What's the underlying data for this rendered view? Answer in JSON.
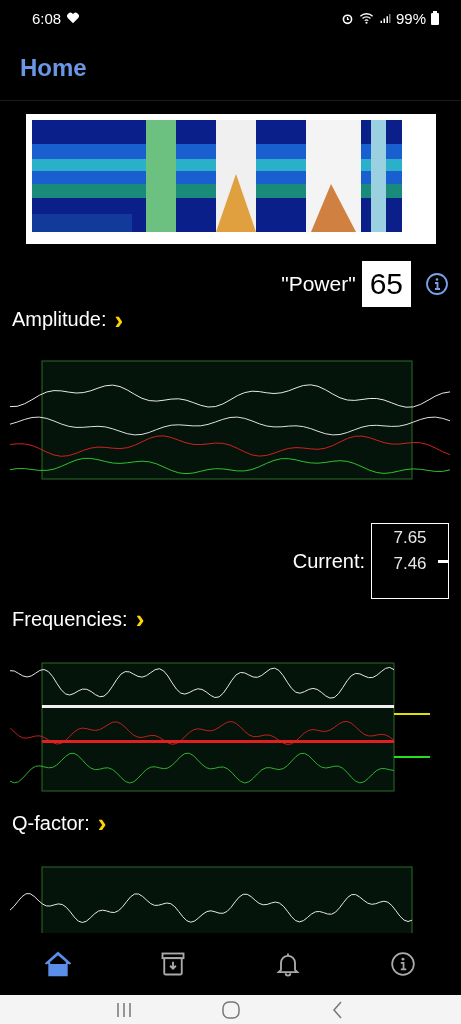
{
  "status_bar": {
    "time": "6:08",
    "battery": "99%"
  },
  "header": {
    "title": "Home"
  },
  "amplitude": {
    "label": "Amplitude:",
    "chevron": "›",
    "power_label": "\"Power\"",
    "power_value": "65"
  },
  "current": {
    "label": "Current:",
    "scale": [
      "7.65",
      "7.46"
    ]
  },
  "frequencies": {
    "label": "Frequencies:",
    "chevron": "›"
  },
  "q_factor": {
    "label": "Q-factor:",
    "chevron": "›"
  },
  "bottom_nav": [
    {
      "kind": "home",
      "selected": true
    },
    {
      "kind": "archive",
      "selected": false
    },
    {
      "kind": "bell",
      "selected": false
    },
    {
      "kind": "info",
      "selected": false
    }
  ]
}
